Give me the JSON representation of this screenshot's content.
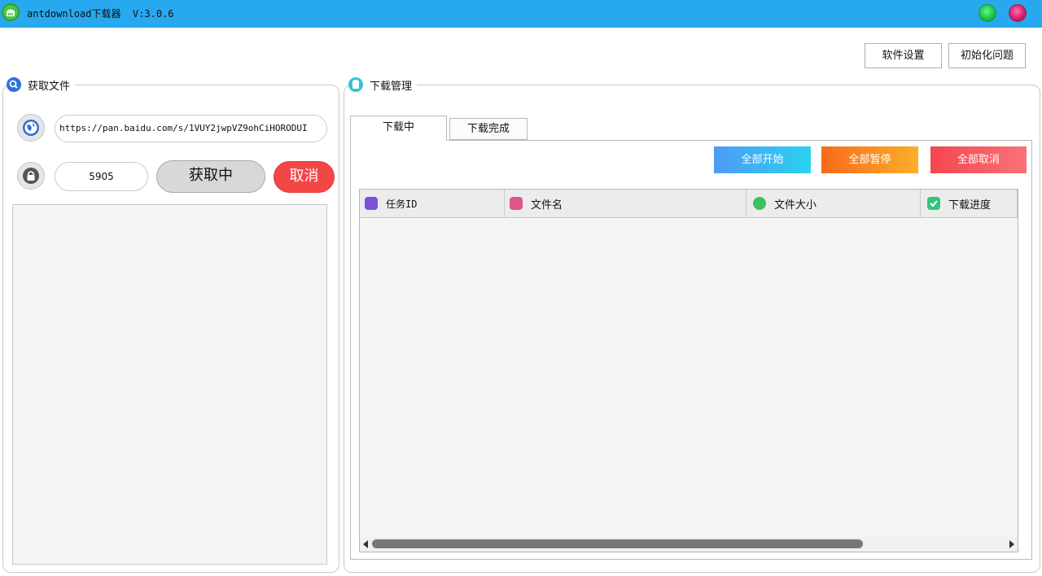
{
  "window": {
    "title": "antdownload下载器  V:3.0.6"
  },
  "toolbar": {
    "settings_label": "软件设置",
    "init_label": "初始化问题"
  },
  "fetch_panel": {
    "title": "获取文件",
    "url_value": "https://pan.baidu.com/s/1VUY2jwpVZ9ohCiHORODUI",
    "code_value": "5905",
    "fetch_button_label": "获取中",
    "cancel_button_label": "取消"
  },
  "download_panel": {
    "title": "下载管理",
    "tabs": [
      {
        "label": "下载中",
        "active": true
      },
      {
        "label": "下载完成",
        "active": false
      }
    ],
    "actions": {
      "start_all": "全部开始",
      "pause_all": "全部暂停",
      "cancel_all": "全部取消"
    },
    "columns": [
      {
        "label": "任务ID",
        "icon": "edit-icon"
      },
      {
        "label": "文件名",
        "icon": "file-icon"
      },
      {
        "label": "文件大小",
        "icon": "android-icon"
      },
      {
        "label": "下载进度",
        "icon": "check-icon"
      }
    ],
    "rows": []
  },
  "colors": {
    "titlebar": "#28a9ef",
    "cancel_red": "#f54646",
    "start_gradient": [
      "#4e9bf7",
      "#2bd1f0"
    ],
    "pause_gradient": [
      "#f76b1c",
      "#fbae2a"
    ],
    "cancel_gradient": [
      "#f3474f",
      "#f87278"
    ]
  }
}
